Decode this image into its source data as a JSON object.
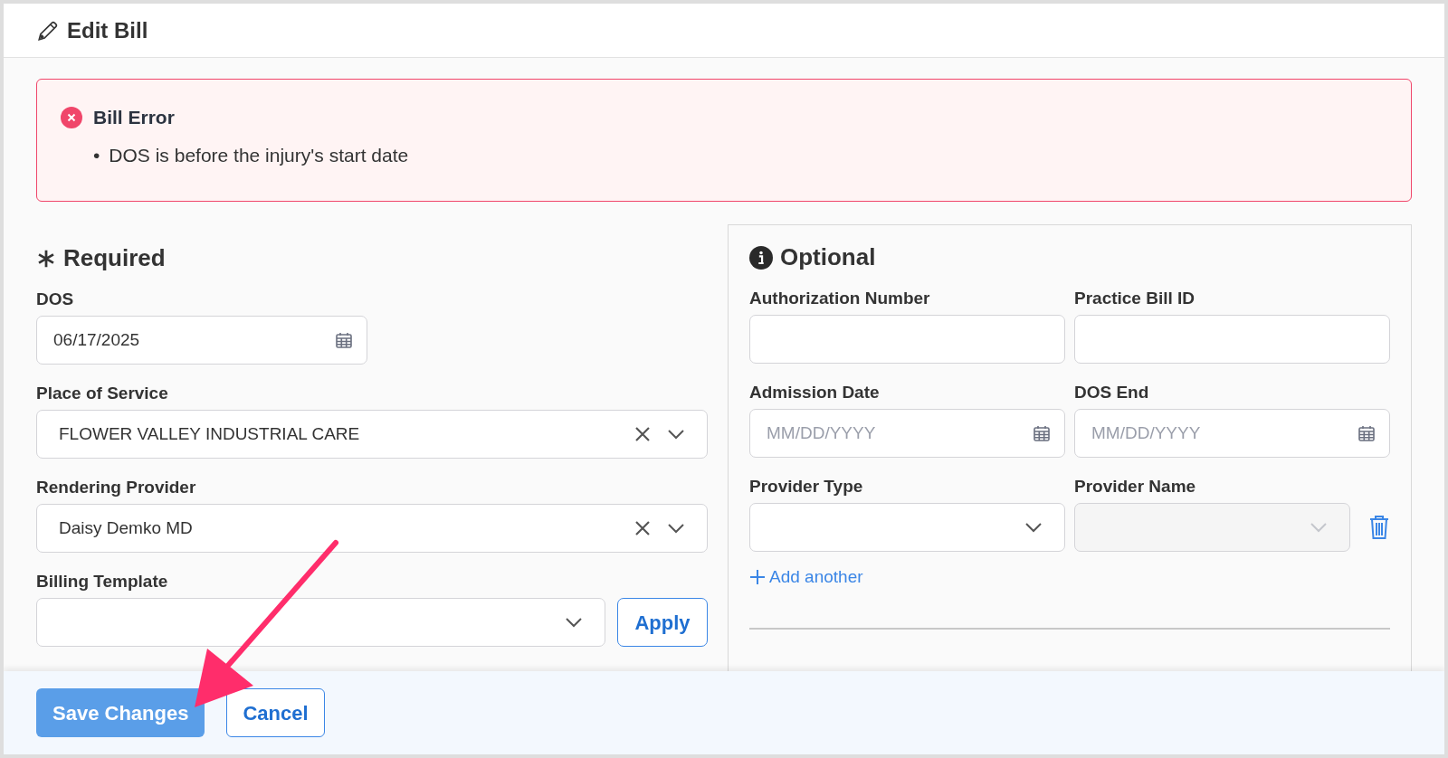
{
  "title": "Edit Bill",
  "error": {
    "title": "Bill Error",
    "messages": [
      {
        "marker": "•",
        "text": "DOS is before the injury's start date"
      }
    ]
  },
  "required": {
    "heading": "Required",
    "fields": [
      {
        "kind": "date",
        "label": "DOS",
        "value": "06/17/2025"
      },
      {
        "kind": "select",
        "label": "Place of Service",
        "value": "FLOWER VALLEY INDUSTRIAL CARE"
      },
      {
        "kind": "select",
        "label": "Rendering Provider",
        "value": "Daisy Demko MD"
      },
      {
        "kind": "select_apply",
        "label": "Billing Template",
        "button": "Apply"
      }
    ]
  },
  "optional": {
    "heading": "Optional",
    "fields": [
      {
        "kind": "text",
        "label": "Authorization Number"
      },
      {
        "kind": "text",
        "label": "Practice Bill ID"
      },
      {
        "kind": "date",
        "label": "Admission Date",
        "placeholder": "MM/DD/YYYY"
      },
      {
        "kind": "date",
        "label": "DOS End",
        "placeholder": "MM/DD/YYYY"
      },
      {
        "kind": "select",
        "label": "Provider Type",
        "disabled": false,
        "removable": false
      },
      {
        "kind": "select",
        "label": "Provider Name",
        "disabled": true,
        "removable": true
      }
    ],
    "add_link": "Add another"
  },
  "footer": {
    "buttons": [
      {
        "label": "Save Changes",
        "kind": "primary"
      },
      {
        "label": "Cancel",
        "kind": "secondary"
      }
    ]
  }
}
